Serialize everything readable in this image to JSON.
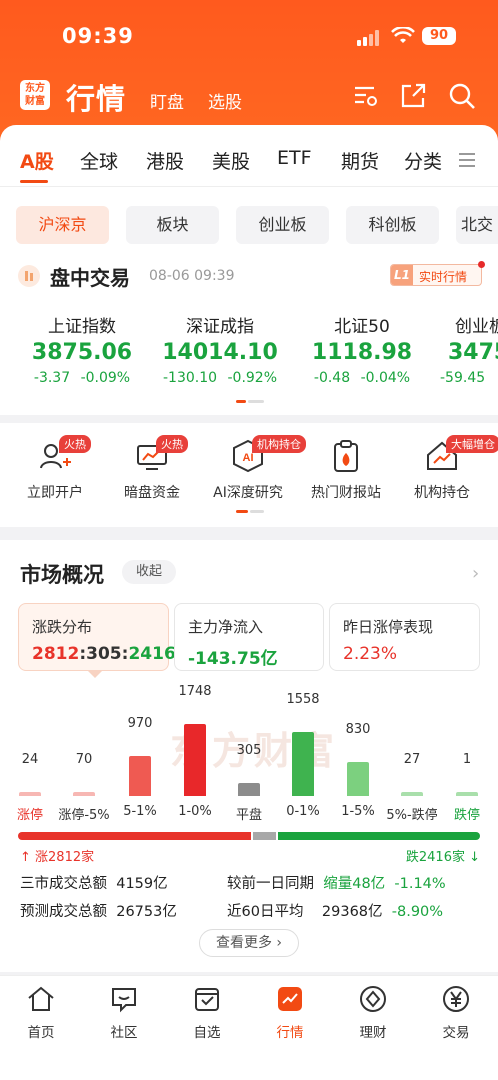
{
  "status_bar": {
    "time": "09:39",
    "battery": "90"
  },
  "header": {
    "logo_line1": "东方",
    "logo_line2": "财富",
    "title": "行情",
    "links": [
      "盯盘",
      "选股"
    ]
  },
  "tabs": [
    "A股",
    "全球",
    "港股",
    "美股",
    "ETF",
    "期货",
    "分类"
  ],
  "chips": [
    "沪深京",
    "板块",
    "创业板",
    "科创板",
    "北交"
  ],
  "trading": {
    "title": "盘中交易",
    "timestamp": "08-06 09:39",
    "badge_l1": "L1",
    "badge_text": "实时行情"
  },
  "indices": [
    {
      "name": "上证指数",
      "value": "3875.06",
      "change": "-3.37",
      "pct": "-0.09%"
    },
    {
      "name": "深证成指",
      "value": "14014.10",
      "change": "-130.10",
      "pct": "-0.92%"
    },
    {
      "name": "北证50",
      "value": "1118.98",
      "change": "-0.48",
      "pct": "-0.04%"
    },
    {
      "name": "创业板",
      "value": "3475",
      "change": "-59.45",
      "pct": ""
    }
  ],
  "quick_items": [
    {
      "label": "立即开户",
      "tag": "火热"
    },
    {
      "label": "暗盘资金",
      "tag": "火热"
    },
    {
      "label": "AI深度研究",
      "tag": "机构持仓"
    },
    {
      "label": "热门财报站",
      "tag": ""
    },
    {
      "label": "机构持仓",
      "tag": "大幅增仓"
    }
  ],
  "market": {
    "title": "市场概况",
    "collapse_label": "收起",
    "cards": [
      {
        "title": "涨跌分布",
        "up": "2812",
        "sep1": ":",
        "flat": "305",
        "sep2": ":",
        "down": "2416"
      },
      {
        "title": "主力净流入",
        "value": "-143.75亿"
      },
      {
        "title": "昨日涨停表现",
        "value": "2.23%"
      }
    ],
    "watermark": "东方财富",
    "legend_up": "涨2812家",
    "legend_down": "跌2416家",
    "stats": {
      "total_turnover_label": "三市成交总额",
      "total_turnover": "4159亿",
      "forecast_label": "预测成交总额",
      "forecast": "26753亿",
      "compare_label": "较前一日同期",
      "compare_value": "缩量48亿",
      "compare_pct": "-1.14%",
      "avg60_label": "近60日平均",
      "avg60_value": "29368亿",
      "avg60_pct": "-8.90%"
    },
    "more_label": "查看更多"
  },
  "chart_data": {
    "type": "bar",
    "categories": [
      "涨停",
      "涨停-5%",
      "5-1%",
      "1-0%",
      "平盘",
      "0-1%",
      "1-5%",
      "5%-跌停",
      "跌停"
    ],
    "values": [
      24,
      70,
      970,
      1748,
      305,
      1558,
      830,
      27,
      1
    ],
    "colors": [
      "#f7b7b3",
      "#f7b7b3",
      "#ef5a52",
      "#e8282a",
      "#8c8c8c",
      "#3fb34f",
      "#7cd07f",
      "#a9dfab",
      "#a9dfab"
    ],
    "ylim": [
      0,
      1748
    ]
  },
  "bottom_nav": [
    {
      "label": "首页",
      "icon": "home-icon"
    },
    {
      "label": "社区",
      "icon": "chat-icon"
    },
    {
      "label": "自选",
      "icon": "checkbox-icon"
    },
    {
      "label": "行情",
      "icon": "chart-icon"
    },
    {
      "label": "理财",
      "icon": "diamond-icon"
    },
    {
      "label": "交易",
      "icon": "yen-icon"
    }
  ],
  "colors": {
    "brand": "#ff5a1e",
    "up": "#e8332a",
    "down": "#1aa33e"
  }
}
